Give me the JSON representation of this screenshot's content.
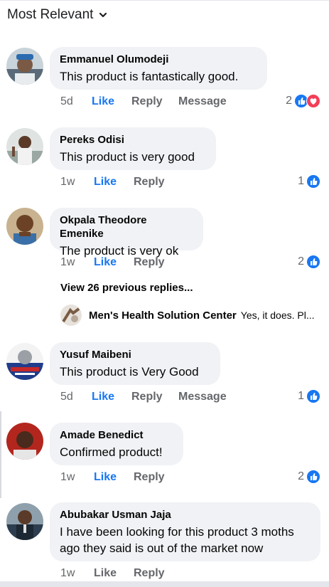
{
  "header": {
    "sort_label": "Most Relevant"
  },
  "comments": [
    {
      "name": "Emmanuel Olumodeji",
      "text": "This product is fantastically good.",
      "time": "5d",
      "like": "Like",
      "reply": "Reply",
      "message": "Message",
      "reactions": "2"
    },
    {
      "name": "Pereks Odisi",
      "text": "This product is very good",
      "time": "1w",
      "like": "Like",
      "reply": "Reply",
      "reactions": "1"
    },
    {
      "name": "Okpala Theodore Emenike",
      "text": "The product is very ok",
      "time": "1w",
      "like": "Like",
      "reply": "Reply",
      "reactions": "2"
    },
    {
      "name": "Yusuf Maibeni",
      "text": "This product is Very Good",
      "time": "5d",
      "like": "Like",
      "reply": "Reply",
      "message": "Message",
      "reactions": "1"
    },
    {
      "name": "Amade Benedict",
      "text": "Confirmed product!",
      "time": "1w",
      "like": "Like",
      "reply": "Reply",
      "reactions": "2"
    },
    {
      "name": "Abubakar Usman Jaja",
      "text_line1": "I have been looking for this product 3 moths",
      "text_line2": "ago they said is out of the market now",
      "time": "1w",
      "like": "Like",
      "reply": "Reply"
    }
  ],
  "replies": {
    "view_previous": "View 26 previous replies...",
    "name": "Men's Health Solution Center",
    "text": "Yes, it does. Pl..."
  },
  "colors": {
    "like_blue": "#1877f2",
    "love_red": "#f33e58",
    "bubble": "#f0f2f5"
  },
  "icons": {
    "like_reaction": "thumbs-up-icon",
    "love_reaction": "heart-icon",
    "sort": "chevron-down-icon"
  }
}
